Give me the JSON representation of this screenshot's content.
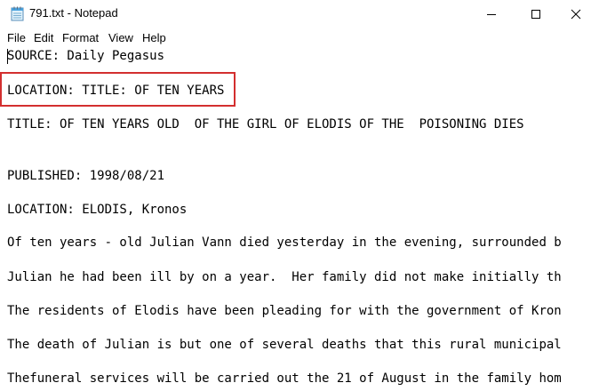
{
  "window": {
    "title": "791.txt - Notepad",
    "icon": "notepad-icon",
    "controls": {
      "minimize": "minimize-icon",
      "maximize": "maximize-icon",
      "close": "close-icon"
    }
  },
  "menu": {
    "file": "File",
    "edit": "Edit",
    "format": "Format",
    "view": "View",
    "help": "Help"
  },
  "editor": {
    "lines": [
      "SOURCE: Daily Pegasus",
      "LOCATION: TITLE: OF TEN YEARS",
      "TITLE: OF TEN YEARS OLD  OF THE GIRL OF ELODIS OF THE  POISONING DIES",
      "PUBLISHED: 1998/08/21",
      "LOCATION: ELODIS, Kronos",
      "Of ten years - old Julian Vann died yesterday in the evening, surrounded b",
      "Julian he had been ill by on a year.  Her family did not make initially th",
      "The residents of Elodis have been pleading for with the government of Kron",
      "The death of Julian is but one of several deaths that this rural municipal",
      "Thefuneral services will be carried out the 21 of August in the family hom"
    ]
  },
  "annotation": {
    "highlight_color": "#d32f2f"
  }
}
